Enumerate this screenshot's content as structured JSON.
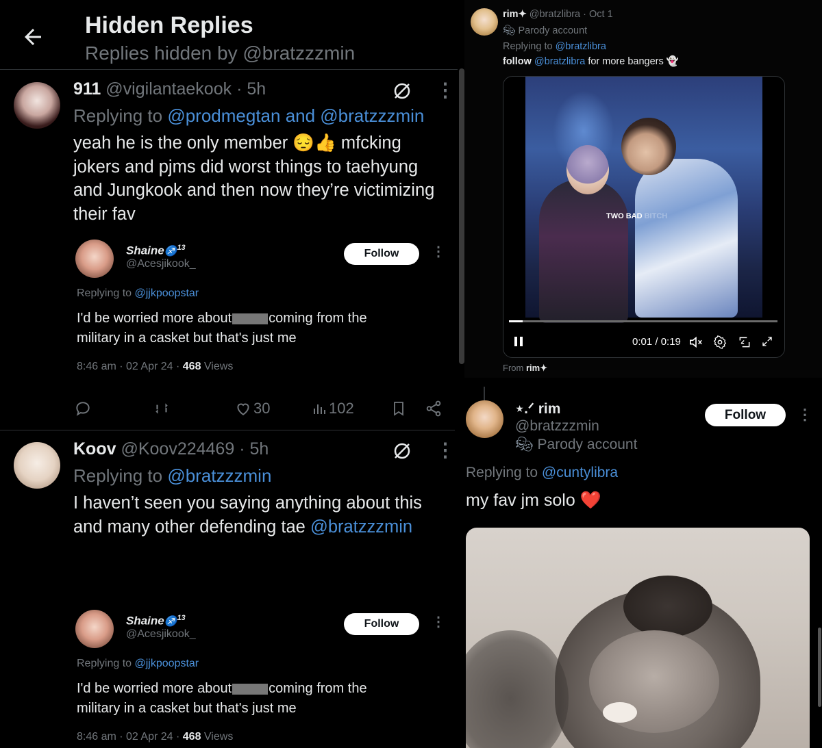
{
  "left": {
    "header": {
      "title": "Hidden Replies",
      "subtitle": "Replies hidden by @bratzzzmin"
    },
    "tweet1": {
      "name": "911",
      "handle": "@vigilantaekook",
      "time": "· 5h",
      "replying_prefix": "Replying to",
      "replying_to": "@prodmegtan and @bratzzzmin",
      "text_line1": "yeah he is the only member 😔👍 mfcking",
      "text_line2": "jokers and pjms did worst things to taehyung",
      "text_line3": "and Jungkook and then now they’re victimizing",
      "text_line4": "their fav",
      "quoted": {
        "name": "Shaine",
        "badge": "13",
        "handle": "@Acesjikook_",
        "follow": "Follow",
        "replying_prefix": "Replying to",
        "replying_to": "@jjkpoopstar",
        "text_part1": "I'd be worried more about",
        "text_part2": "coming from the",
        "text_line2": "military in a casket but that's just me",
        "time": "8:46 am · 02 Apr 24 ·",
        "views_count": "468",
        "views_label": "Views"
      },
      "actions": {
        "likes": "30",
        "views": "102"
      }
    },
    "tweet2": {
      "name": "Koov",
      "handle": "@Koov224469",
      "time": "· 5h",
      "replying_prefix": "Replying to",
      "replying_to": "@bratzzzmin",
      "text_line1": "I haven’t seen you saying anything about this",
      "text_line2": "and many other defending tae",
      "text_mention": "@bratzzzmin",
      "quoted": {
        "name": "Shaine",
        "badge": "13",
        "handle": "@Acesjikook_",
        "follow": "Follow",
        "replying_prefix": "Replying to",
        "replying_to": "@jjkpoopstar",
        "text_part1": "I'd be worried more about",
        "text_part2": "coming from the",
        "text_line2": "military in a casket but that's just me",
        "time": "8:46 am · 02 Apr 24 ·",
        "views_count": "468",
        "views_label": "Views"
      }
    }
  },
  "top_right": {
    "name": "rim",
    "handle": "@bratzlibra",
    "time": "· Oct 1",
    "parody": "Parody account",
    "replying_prefix": "Replying to",
    "replying_to": "@bratzlibra",
    "bold_word": "follow",
    "mention": "@bratzlibra",
    "suffix": "for more bangers",
    "video": {
      "caption": "TWO BAD",
      "caption_faded": "BITCH",
      "time": "0:01 / 0:19",
      "progress": 0.05
    },
    "from_prefix": "From",
    "from_name": "rim"
  },
  "bottom_right": {
    "name": "⋆.ᐟ rim",
    "handle": "@bratzzzmin",
    "parody": "Parody account",
    "follow": "Follow",
    "replying_prefix": "Replying to",
    "replying_to": "@cuntylibra",
    "text": "my fav jm solo ❤️"
  },
  "colors": {
    "background": "#000000",
    "link": "#4a8fd8",
    "muted": "#71767b",
    "text": "#e7e9ea"
  }
}
